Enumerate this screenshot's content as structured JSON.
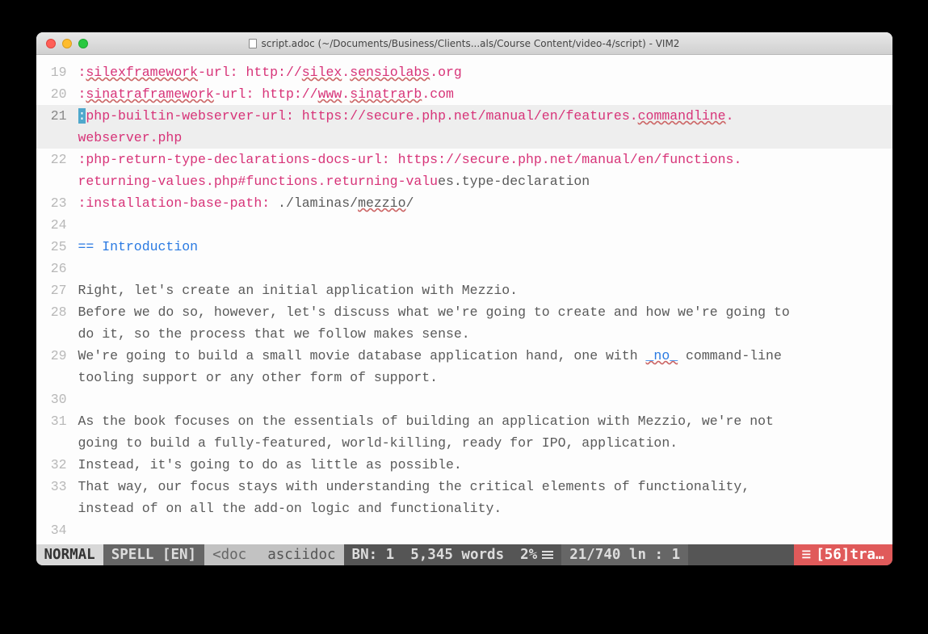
{
  "window": {
    "title": "script.adoc (~/Documents/Business/Clients...als/Course Content/video-4/script) - VIM2"
  },
  "lines": {
    "l19": {
      "num": "19",
      "attr_start": ":",
      "attr_name": "silexframework",
      "attr_suffix": "-url:",
      "url_proto": "http://",
      "url_host1": "silex",
      "url_dot1": ".",
      "url_host2": "sensiolabs",
      "url_rest": ".org"
    },
    "l20": {
      "num": "20",
      "attr_start": ":",
      "attr_name": "sinatraframework",
      "attr_suffix": "-url:",
      "url_proto": " http://",
      "url_host1": "www",
      "url_dot1": ".",
      "url_host2": "sinatrarb",
      "url_rest": ".com"
    },
    "l21": {
      "num": "21",
      "cursor": ":",
      "attr_rest": "php-builtin-webserver-url:",
      "url": " https://secure.php.net/manual/en/features.",
      "url_last": "commandline",
      "url_tail": "."
    },
    "l21b": {
      "wrap": "webserver.php"
    },
    "l22": {
      "num": "22",
      "attr": ":php-return-type-declarations-docs-url:",
      "url": " https://secure.php.net/manual/en/functions."
    },
    "l22b": {
      "wrap_attr": "returning-values.php#functions.returning-valu",
      "wrap_rest": "es.type-declaration"
    },
    "l23": {
      "num": "23",
      "attr": ":installation-base-path:",
      "path_pre": " ./laminas/",
      "path_name": "mezzio",
      "path_post": "/"
    },
    "l24": {
      "num": "24"
    },
    "l25": {
      "num": "25",
      "heading": "== Introduction"
    },
    "l26": {
      "num": "26"
    },
    "l27": {
      "num": "27",
      "text": "Right, let's create an initial application with Mezzio."
    },
    "l28": {
      "num": "28",
      "text": "Before we do so, however, let's discuss what we're going to create and how we're going to"
    },
    "l28b": {
      "wrap": "do it, so the process that we follow makes sense."
    },
    "l29": {
      "num": "29",
      "text_pre": "We're going to build a small movie database application hand, one with ",
      "emph": "_no_",
      "text_post": " command-line"
    },
    "l29b": {
      "wrap": "tooling support or any other form of support."
    },
    "l30": {
      "num": "30"
    },
    "l31": {
      "num": "31",
      "text": "As the book focuses on the essentials of building an application with Mezzio, we're not"
    },
    "l31b": {
      "wrap": "going to build a fully-featured, world-killing, ready for IPO, application."
    },
    "l32": {
      "num": "32",
      "text": "Instead, it's going to do as little as possible."
    },
    "l33": {
      "num": "33",
      "text": "That way, our focus stays with understanding the critical elements of functionality,"
    },
    "l33b": {
      "wrap": "instead of on all the add-on logic and functionality."
    },
    "l34": {
      "num": "34"
    }
  },
  "statusbar": {
    "mode": "NORMAL",
    "spell": "SPELL [EN]",
    "doc": "<doc",
    "filetype": "asciidoc",
    "buffer": "BN: 1",
    "words": "5,345 words",
    "percent": "2%",
    "position": "21/740 ln :  1",
    "trailing": "[56]tra…"
  }
}
